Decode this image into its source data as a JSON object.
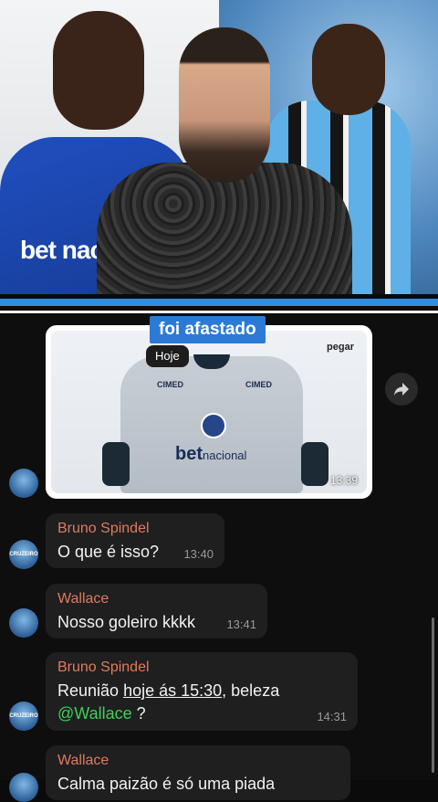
{
  "video": {
    "left_sponsor": "bet naci"
  },
  "caption": "foi afastado",
  "image_message": {
    "date_chip": "Hoje",
    "overlay_text": "pegar",
    "jersey_logo_left": "CIMED",
    "jersey_logo_right": "CIMED",
    "jersey_sponsor_bold": "bet",
    "jersey_sponsor_rest": "nacional",
    "time": "13:39"
  },
  "messages": [
    {
      "sender": "Bruno Spindel",
      "text": "O que é isso?",
      "time": "13:40",
      "avatar_label": "CRUZEIRO"
    },
    {
      "sender": "Wallace",
      "text": "Nosso goleiro kkkk",
      "time": "13:41",
      "avatar_label": ""
    },
    {
      "sender": "Bruno Spindel",
      "text_prefix": "Reunião ",
      "text_underlined": "hoje ás 15:30",
      "text_suffix": ", beleza",
      "mention": "@Wallace",
      "mention_suffix": " ?",
      "time": "14:31",
      "avatar_label": "CRUZEIRO"
    },
    {
      "sender": "Wallace",
      "text": "Calma paizão é só uma piada",
      "time": "",
      "avatar_label": ""
    }
  ],
  "colors": {
    "accent_blue": "#2b7bd6",
    "sender_name": "#e07a5f",
    "mention": "#3fcf5a",
    "bubble": "#1f1f1f"
  },
  "icons": {
    "forward": "forward-arrow-icon"
  }
}
